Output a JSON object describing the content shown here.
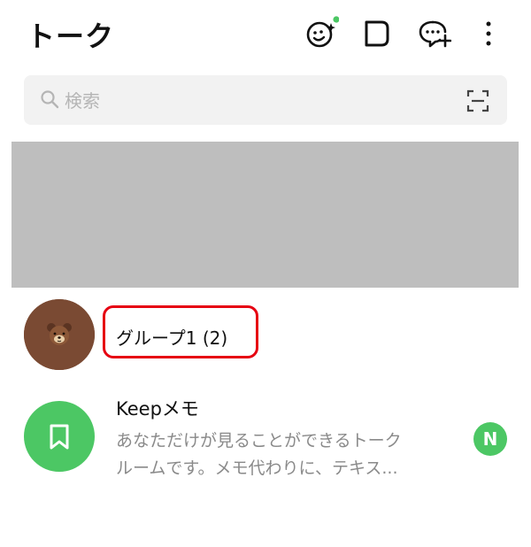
{
  "header": {
    "title": "トーク",
    "icons": [
      "face-sparkle-icon",
      "square-icon",
      "chat-add-icon",
      "more-vertical-icon"
    ]
  },
  "search": {
    "placeholder": "検索"
  },
  "chats": [
    {
      "name": "グループ1 (2)",
      "avatar": "brown-bear-avatar",
      "highlighted": true
    },
    {
      "name": "Keepメモ",
      "avatar": "bookmark-icon",
      "preview_line1": "あなただけが見ることができるトーク",
      "preview_line2": "ルームです。メモ代わりに、テキス...",
      "badge": "N"
    }
  ],
  "colors": {
    "accent_green": "#4cc764",
    "highlight_red": "#e60012",
    "banner_gray": "#bebebe"
  }
}
